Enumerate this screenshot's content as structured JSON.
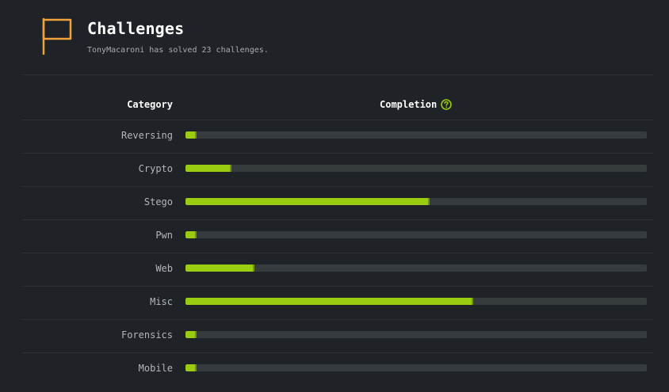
{
  "header": {
    "title": "Challenges",
    "subtitle": "TonyMacaroni has solved 23 challenges.",
    "icon": "flag-icon",
    "accent": "#f0a33a"
  },
  "table": {
    "columns": {
      "category": "Category",
      "completion": "Completion"
    },
    "help_icon": "question-circle-icon",
    "colors": {
      "bar_fill": "#9acd0f",
      "bar_track": "#363b3d"
    },
    "rows": [
      {
        "label": "Reversing",
        "completion_pct": 2.4
      },
      {
        "label": "Crypto",
        "completion_pct": 10
      },
      {
        "label": "Stego",
        "completion_pct": 53
      },
      {
        "label": "Pwn",
        "completion_pct": 2.4
      },
      {
        "label": "Web",
        "completion_pct": 15
      },
      {
        "label": "Misc",
        "completion_pct": 62.4
      },
      {
        "label": "Forensics",
        "completion_pct": 2.4
      },
      {
        "label": "Mobile",
        "completion_pct": 2.4
      }
    ]
  }
}
